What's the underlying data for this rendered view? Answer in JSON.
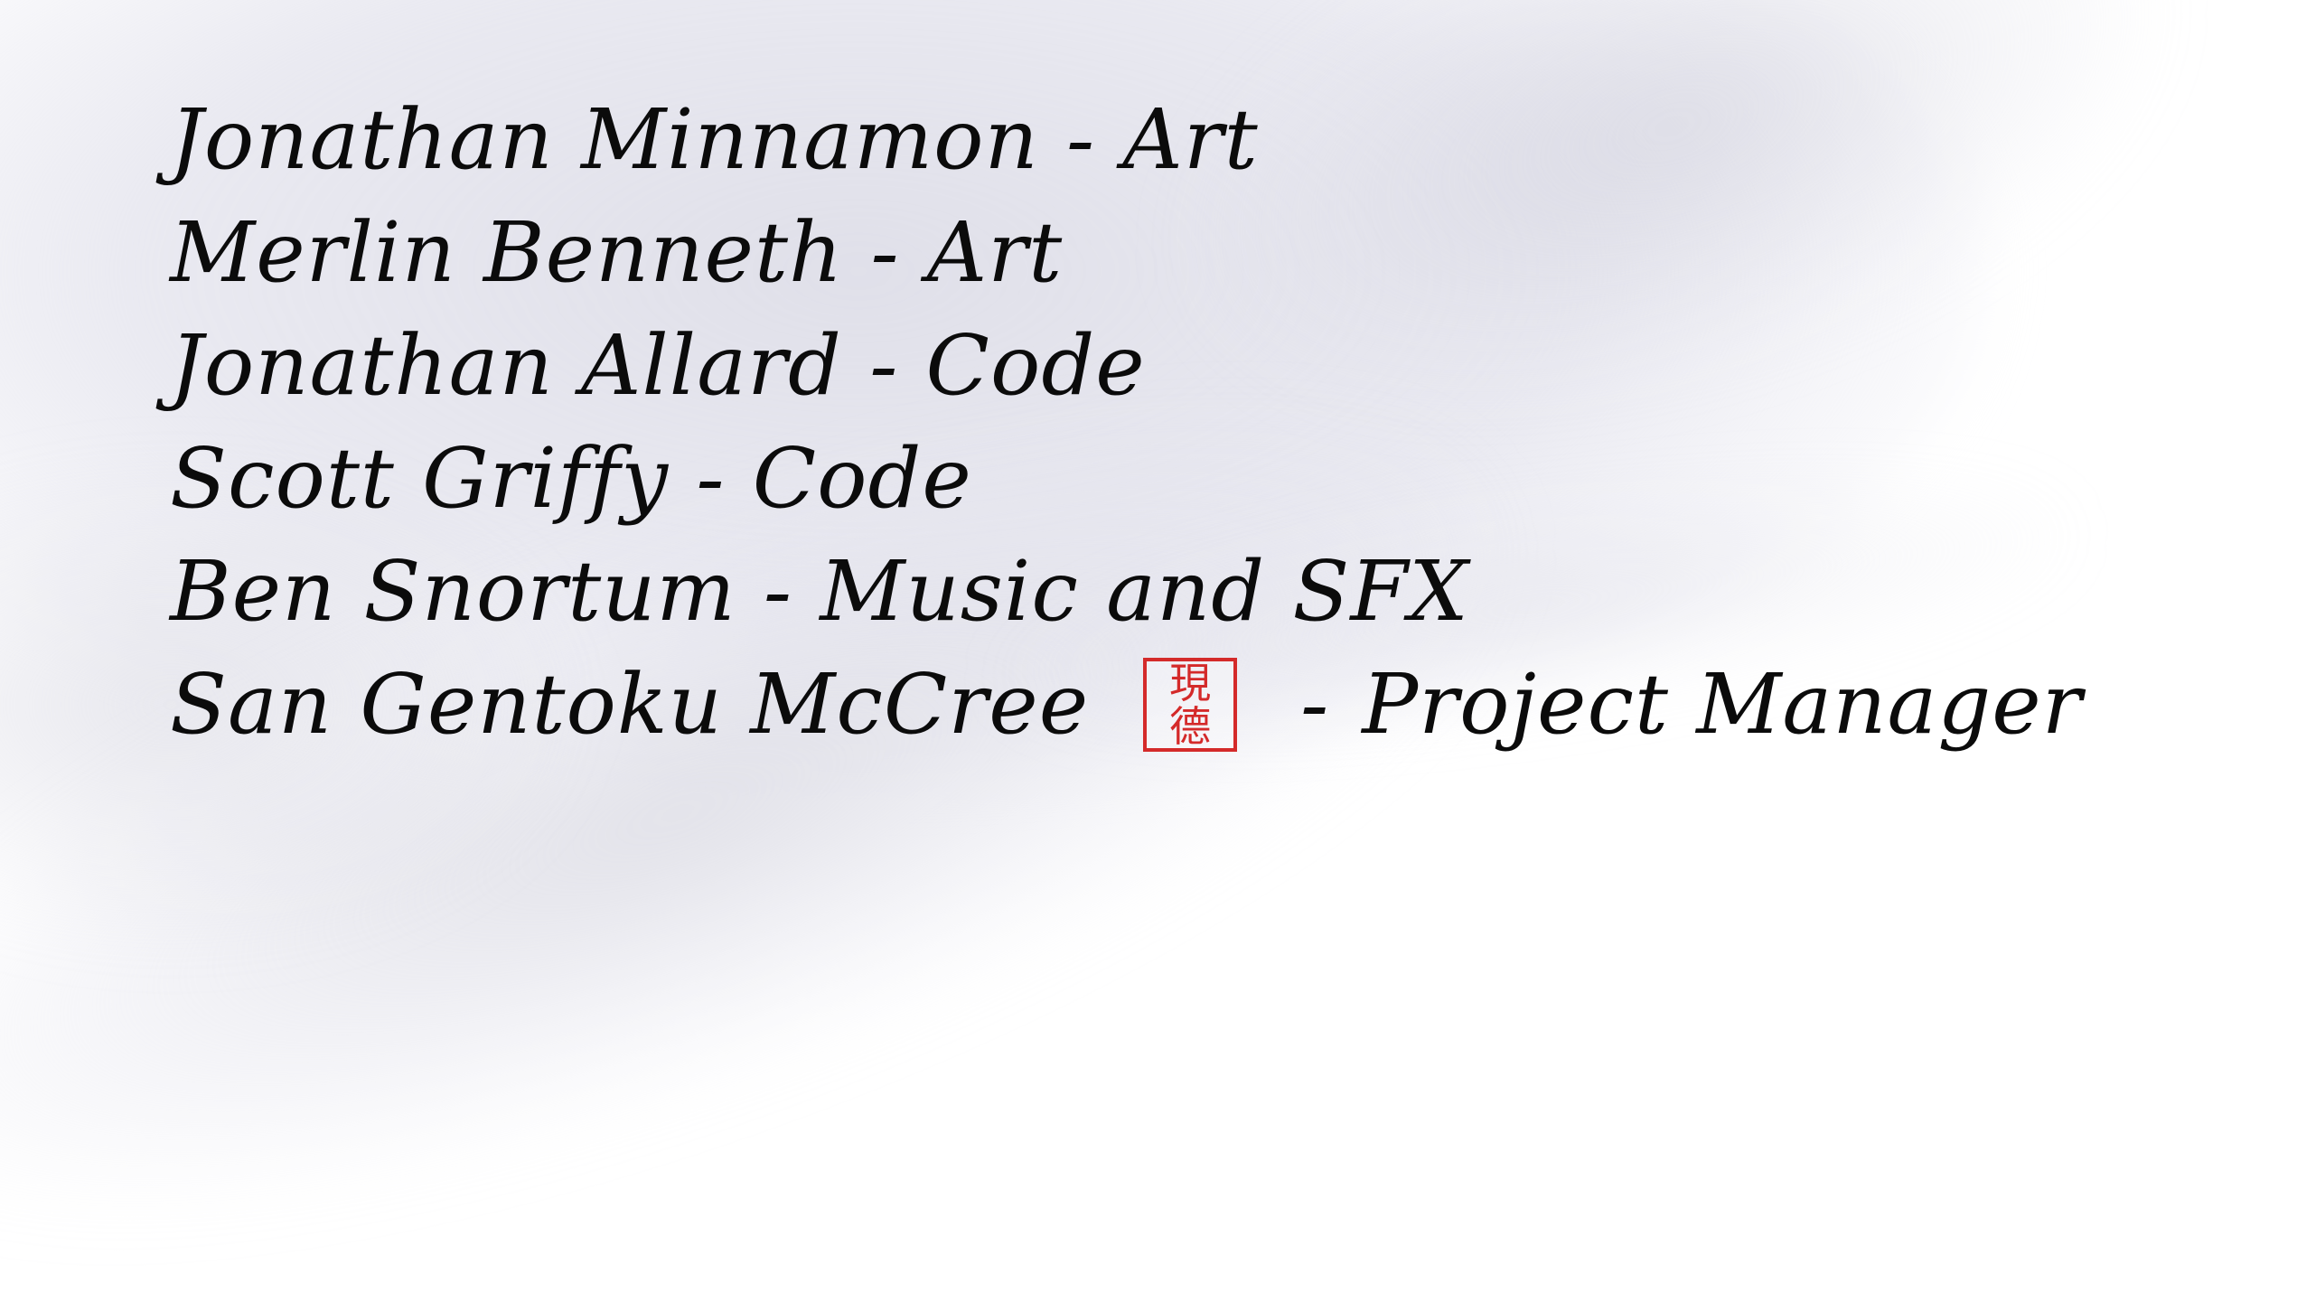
{
  "credits": [
    {
      "name": "Jonathan Minnamon",
      "separator": "-",
      "role": "Art"
    },
    {
      "name": "Merlin Benneth",
      "separator": "-",
      "role": "Art"
    },
    {
      "name": "Jonathan Allard",
      "separator": "-",
      "role": "Code"
    },
    {
      "name": "Scott Griffy",
      "separator": "-",
      "role": "Code"
    },
    {
      "name": "Ben Snortum",
      "separator": "-",
      "role": "Music and SFX"
    },
    {
      "name": "San Gentoku McCree",
      "seal": {
        "glyph_top": "現",
        "glyph_bottom": "德",
        "color": "#d42a2a"
      },
      "separator": "-",
      "role": "Project Manager"
    }
  ],
  "colors": {
    "text": "#0b0b0b",
    "background": "#ffffff",
    "wash": "#dedee8",
    "seal": "#d42a2a"
  }
}
